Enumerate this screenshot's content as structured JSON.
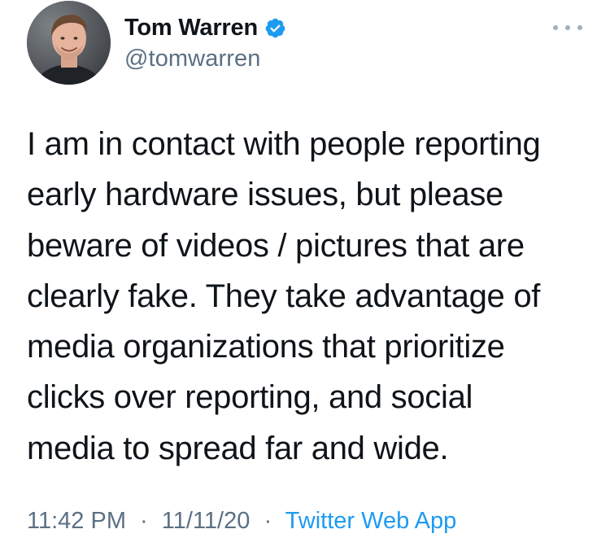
{
  "author": {
    "display_name": "Tom Warren",
    "handle": "@tomwarren",
    "verified": true,
    "verified_icon": "verified-badge-icon",
    "avatar": "avatar-photo"
  },
  "more_icon": "more-options-icon",
  "tweet": {
    "lines": [
      "I am in contact with people reporting",
      "early hardware issues, but please",
      "beware of videos / pictures that are",
      "clearly fake. They take advantage of",
      "media organizations that prioritize",
      "clicks over reporting, and social",
      "media to spread far and wide."
    ]
  },
  "meta": {
    "time": "11:42 PM",
    "separator": "·",
    "date": "11/11/20",
    "source": "Twitter Web App"
  },
  "colors": {
    "text": "#0f1419",
    "secondary": "#5b7083",
    "link": "#1d9bf0",
    "verified": "#1d9bf0"
  }
}
